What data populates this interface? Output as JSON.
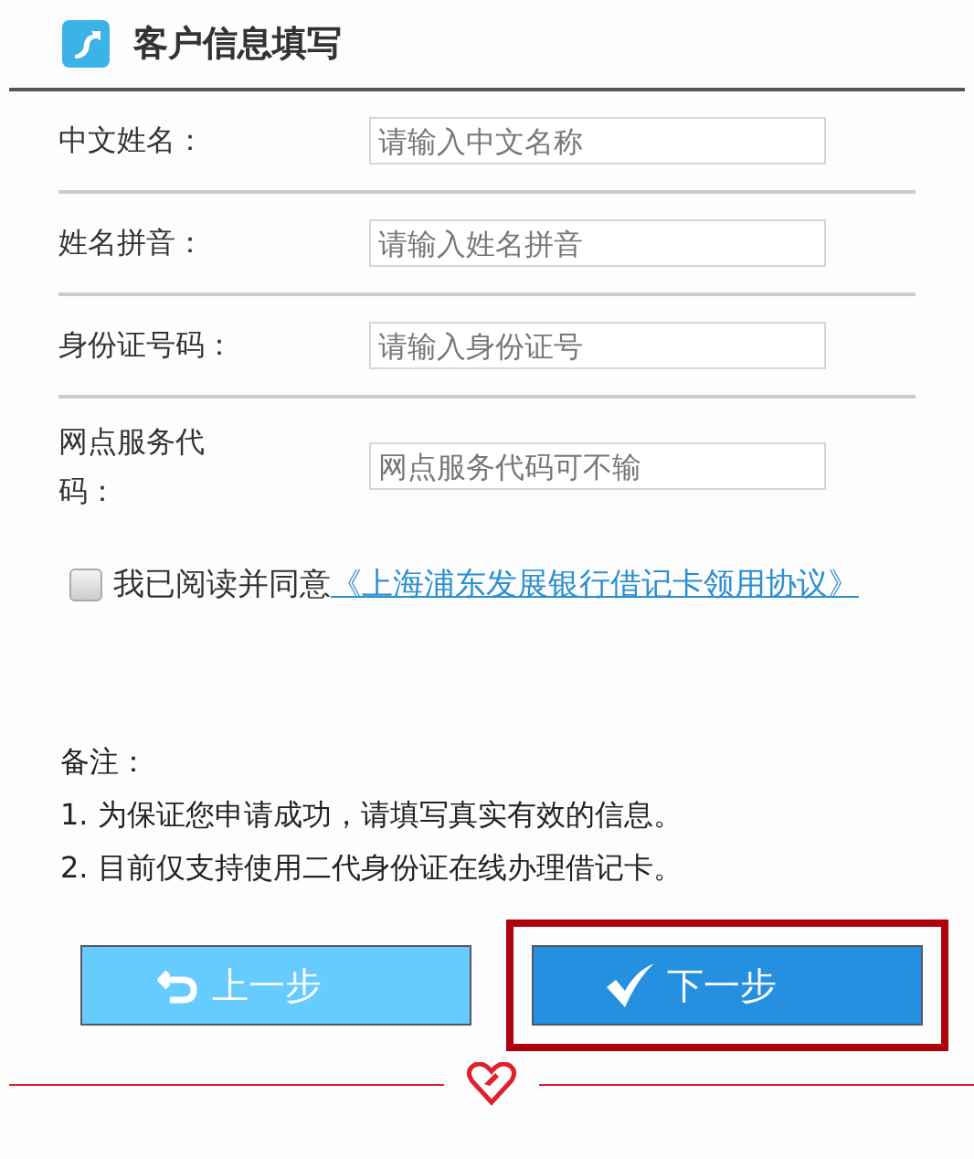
{
  "header": {
    "title": "客户信息填写"
  },
  "fields": [
    {
      "label": "中文姓名：",
      "placeholder": "请输入中文名称"
    },
    {
      "label": "姓名拼音：",
      "placeholder": "请输入姓名拼音"
    },
    {
      "label": "身份证号码：",
      "placeholder": "请输入身份证号"
    },
    {
      "label": "网点服务代码：",
      "placeholder": "网点服务代码可不输"
    }
  ],
  "agreement": {
    "checked": false,
    "text": "我已阅读并同意",
    "link": "《上海浦东发展银行借记卡领用协议》"
  },
  "notes": [
    "备注：",
    "1. 为保证您申请成功，请填写真实有效的信息。",
    "2. 目前仅支持使用二代身份证在线办理借记卡。"
  ],
  "buttons": [
    {
      "kind": "back",
      "label": "上一步",
      "highlighted": false
    },
    {
      "kind": "next",
      "label": "下一步",
      "highlighted": true
    }
  ]
}
